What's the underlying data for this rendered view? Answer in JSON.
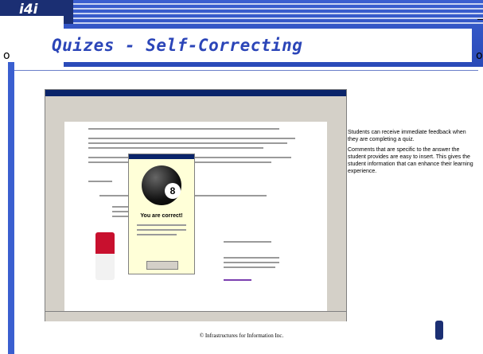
{
  "header": {
    "logo_text": "i4i",
    "title": "Quizes - Self-Correcting",
    "left_bullet": "o",
    "right_bullet": "o"
  },
  "screenshot": {
    "dialog_heading": "You are correct!"
  },
  "side_text": {
    "paragraph_1": "Students can receive immediate feedback when they are completing a quiz.",
    "paragraph_2": "Comments that are specific to the answer the student provides are easy to insert. This gives the student information that can enhance their learning experience."
  },
  "footer": {
    "copyright": "© Infrastructures for Information Inc."
  },
  "colors": {
    "header_blue": "#3a5fd0",
    "title_blue": "#2b45b8",
    "logo_navy": "#1b2f73"
  }
}
